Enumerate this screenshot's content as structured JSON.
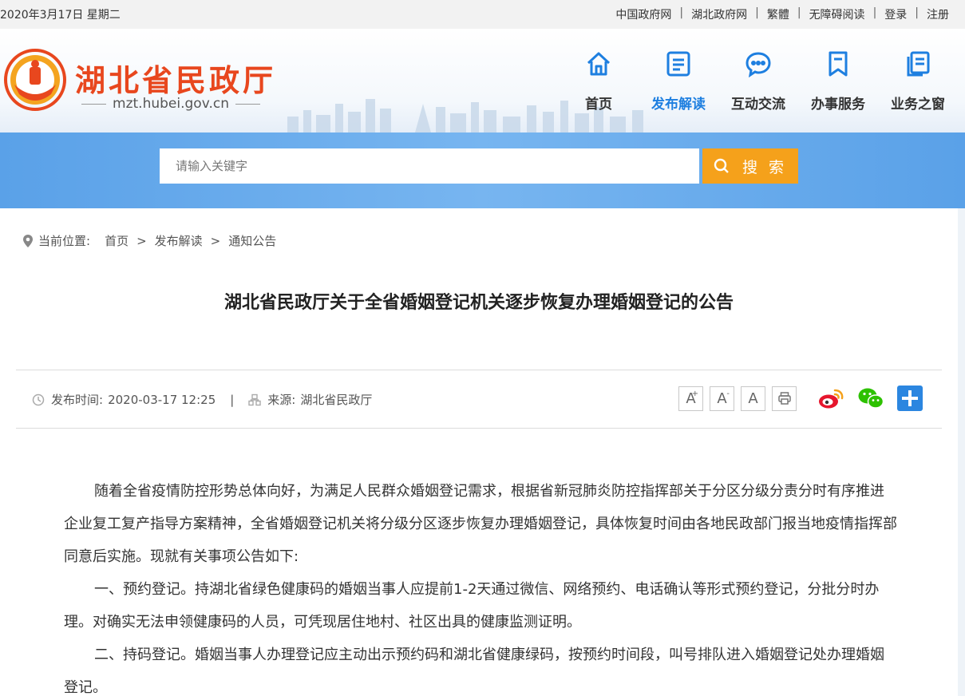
{
  "topbar": {
    "date": "2020年3月17日 星期二",
    "links": [
      "中国政府网",
      "湖北政府网",
      "繁體",
      "无障碍阅读",
      "登录",
      "注册"
    ]
  },
  "header": {
    "site_name": "湖北省民政厅",
    "domain": "mzt.hubei.gov.cn",
    "nav": [
      {
        "label": "首页",
        "icon": "home-icon"
      },
      {
        "label": "发布解读",
        "icon": "document-icon"
      },
      {
        "label": "互动交流",
        "icon": "chat-icon"
      },
      {
        "label": "办事服务",
        "icon": "bookmark-icon"
      },
      {
        "label": "业务之窗",
        "icon": "files-icon"
      }
    ]
  },
  "search": {
    "placeholder": "请输入关键字",
    "button_label": "搜 索"
  },
  "breadcrumb": {
    "prefix": "当前位置:",
    "items": [
      "首页",
      "发布解读",
      "通知公告"
    ],
    "separator": ">"
  },
  "article": {
    "title": "湖北省民政厅关于全省婚姻登记机关逐步恢复办理婚姻登记的公告",
    "publish_label": "发布时间:",
    "publish_time": "2020-03-17 12:25",
    "meta_divider": "|",
    "source_label": "来源:",
    "source": "湖北省民政厅",
    "font_tools": {
      "larger": "A",
      "larger_mark": "+",
      "smaller": "A",
      "smaller_mark": "-",
      "normal": "A"
    },
    "paragraphs": [
      "随着全省疫情防控形势总体向好，为满足人民群众婚姻登记需求，根据省新冠肺炎防控指挥部关于分区分级分责分时有序推进企业复工复产指导方案精神，全省婚姻登记机关将分级分区逐步恢复办理婚姻登记，具体恢复时间由各地民政部门报当地疫情指挥部同意后实施。现就有关事项公告如下:",
      "一、预约登记。持湖北省绿色健康码的婚姻当事人应提前1-2天通过微信、网络预约、电话确认等形式预约登记，分批分时办理。对确实无法申领健康码的人员，可凭现居住地村、社区出具的健康监测证明。",
      "二、持码登记。婚姻当事人办理登记应主动出示预约码和湖北省健康绿码，按预约时间段，叫号排队进入婚姻登记处办理婚姻登记。"
    ]
  },
  "colors": {
    "brand_red": "#e8471e",
    "nav_active": "#1e7fe0",
    "search_button": "#f5a11b",
    "search_band": "#6aaaeb",
    "weibo": "#e6162d",
    "wechat": "#2dc100",
    "share_plus": "#2b86e0"
  }
}
